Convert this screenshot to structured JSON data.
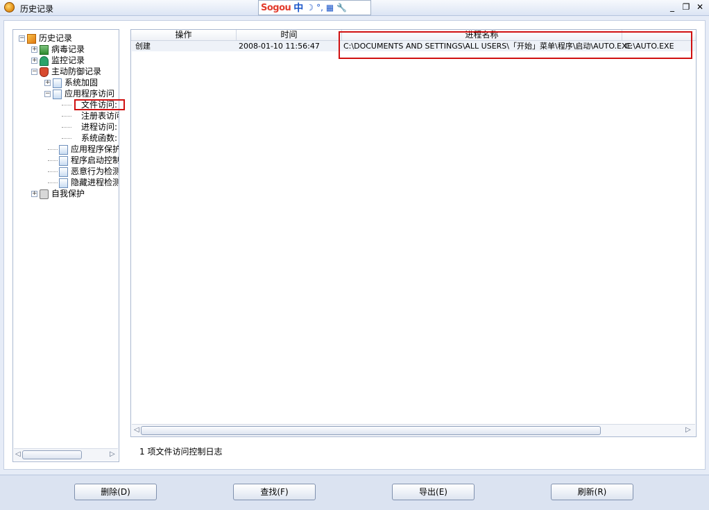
{
  "window": {
    "title": "历史记录"
  },
  "ime": {
    "logo": "Sogou",
    "mode": "中",
    "moon": "☽",
    "deg": "°,",
    "keyboard": "▦",
    "tools": "🔧"
  },
  "controls": {
    "minimize": "_",
    "restore": "❐",
    "close": "✕"
  },
  "tree": {
    "root": "历史记录",
    "virus_log": "病毒记录",
    "monitor_log": "监控记录",
    "defense_log": "主动防御记录",
    "sys_harden": "系统加固",
    "app_access": "应用程序访问",
    "file_access": "文件访问:",
    "reg_access": "注册表访问",
    "proc_access": "进程访问:",
    "sys_func": "系统函数:",
    "app_protect": "应用程序保护",
    "startup_ctrl": "程序启动控制",
    "malicious_detect": "恶意行为检测",
    "hidden_proc": "隐藏进程检测",
    "self_protect": "自我保护"
  },
  "table": {
    "headers": [
      "操作",
      "时间",
      "进程名称"
    ],
    "rows": [
      {
        "op": "创建",
        "time": "2008-01-10 11:56:47",
        "process": "C:\\DOCUMENTS AND SETTINGS\\ALL USERS\\「开始」菜单\\程序\\启动\\AUTO.EXE",
        "target": "C:\\AUTO.EXE"
      }
    ]
  },
  "status": "1 项文件访问控制日志",
  "buttons": {
    "delete": "删除(D)",
    "find": "查找(F)",
    "export": "导出(E)",
    "refresh": "刷新(R)"
  }
}
